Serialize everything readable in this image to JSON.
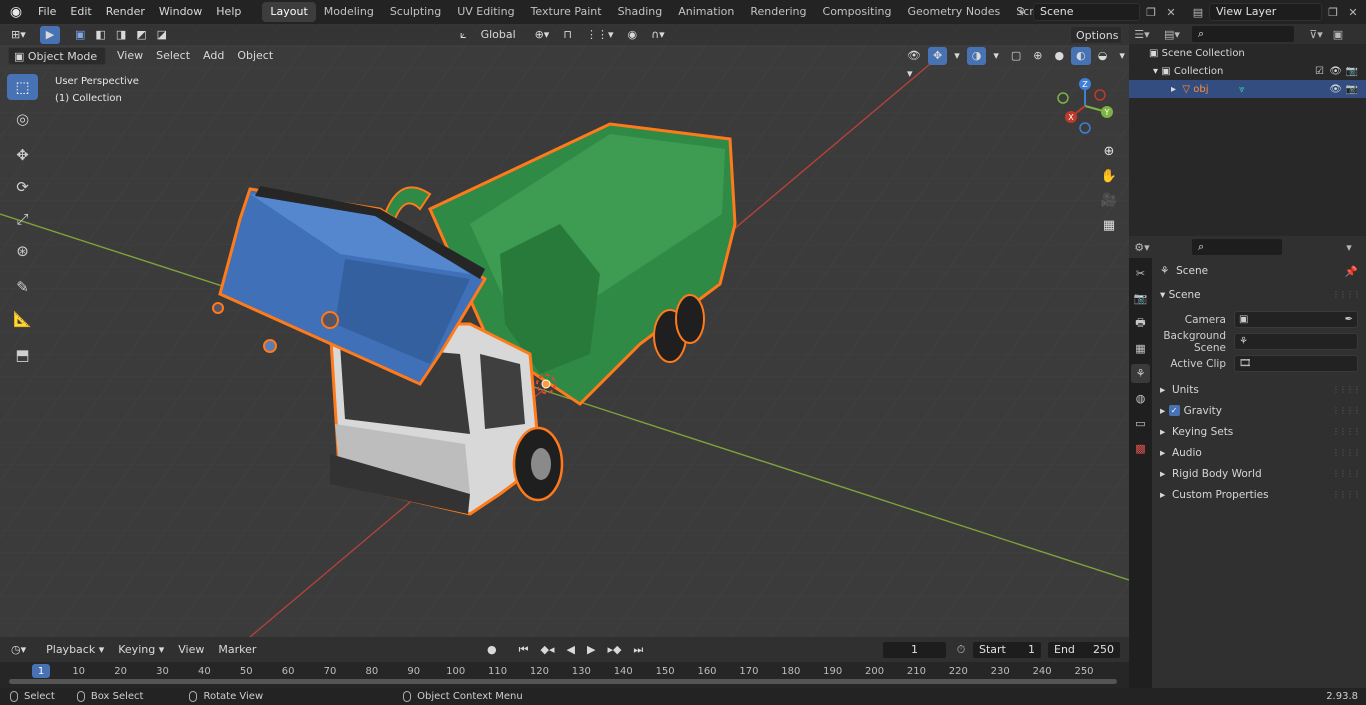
{
  "colors": {
    "accent": "#4772b3",
    "selection_outline": "#ff7a1a",
    "axis_x": "#c0392b",
    "axis_y": "#7cb342",
    "axis_z": "#3f7fd6",
    "viewport_bg": "#3b3b3b"
  },
  "menu": [
    "File",
    "Edit",
    "Render",
    "Window",
    "Help"
  ],
  "workspaces": [
    "Layout",
    "Modeling",
    "Sculpting",
    "UV Editing",
    "Texture Paint",
    "Shading",
    "Animation",
    "Rendering",
    "Compositing",
    "Geometry Nodes",
    "Scripting"
  ],
  "active_workspace": "Layout",
  "scene": {
    "name": "Scene",
    "view_layer": "View Layer"
  },
  "viewport": {
    "mode": "Object Mode",
    "menus": [
      "View",
      "Select",
      "Add",
      "Object"
    ],
    "transform_orientation": "Global",
    "options_label": "Options",
    "perspective_label": "User Perspective",
    "collection_label": "(1) Collection",
    "gizmo_axes": [
      "X",
      "Y",
      "Z"
    ]
  },
  "tools": [
    "select-box",
    "cursor",
    "move",
    "rotate",
    "scale",
    "transform",
    "annotate",
    "measure",
    "add-cube"
  ],
  "outliner": {
    "search_placeholder": "",
    "root": "Scene Collection",
    "collection": "Collection",
    "object": "obj"
  },
  "properties": {
    "context": "Scene",
    "section": "Scene",
    "fields": [
      {
        "label": "Camera",
        "value": ""
      },
      {
        "label": "Background Scene",
        "value": ""
      },
      {
        "label": "Active Clip",
        "value": ""
      }
    ],
    "panels": [
      "Units",
      "Gravity",
      "Keying Sets",
      "Audio",
      "Rigid Body World",
      "Custom Properties"
    ],
    "gravity_checked": true
  },
  "timeline": {
    "menus": [
      "Playback",
      "Keying",
      "View",
      "Marker"
    ],
    "current_frame": "1",
    "start_label": "Start",
    "start": "1",
    "end_label": "End",
    "end": "250",
    "ticks": [
      "1",
      "10",
      "20",
      "30",
      "40",
      "50",
      "60",
      "70",
      "80",
      "90",
      "100",
      "110",
      "120",
      "130",
      "140",
      "150",
      "160",
      "170",
      "180",
      "190",
      "200",
      "210",
      "220",
      "230",
      "240",
      "250"
    ]
  },
  "status": {
    "items": [
      "Select",
      "Box Select",
      "Rotate View",
      "Object Context Menu"
    ],
    "version": "2.93.8"
  }
}
